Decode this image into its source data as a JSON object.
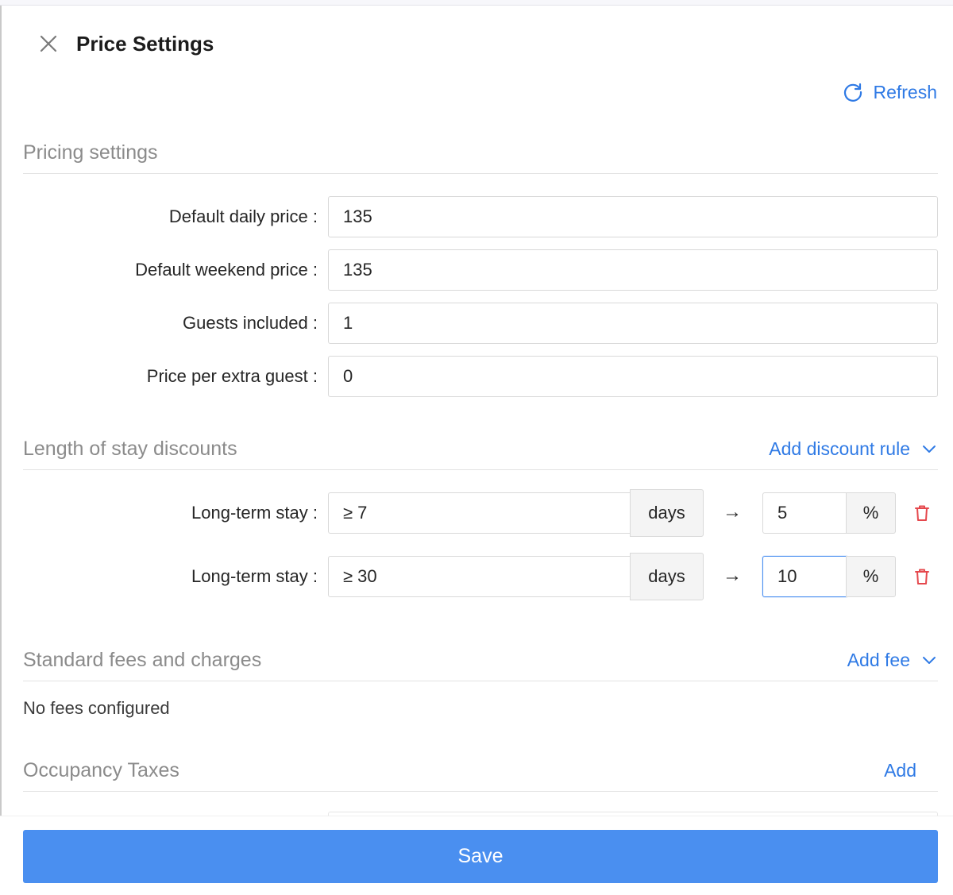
{
  "drawer": {
    "title": "Price Settings",
    "refresh_label": "Refresh",
    "save_label": "Save"
  },
  "pricing": {
    "section_title": "Pricing settings",
    "fields": [
      {
        "label": "Default daily price",
        "value": "135"
      },
      {
        "label": "Default weekend price",
        "value": "135"
      },
      {
        "label": "Guests included",
        "value": "1"
      },
      {
        "label": "Price per extra guest",
        "value": "0"
      }
    ]
  },
  "discounts": {
    "section_title": "Length of stay discounts",
    "add_label": "Add discount rule",
    "rules": [
      {
        "label": "Long-term stay",
        "min_days": "≥ 7",
        "days_unit": "days",
        "arrow": "→",
        "percent": "5",
        "percent_unit": "%"
      },
      {
        "label": "Long-term stay",
        "min_days": "≥ 30",
        "days_unit": "days",
        "arrow": "→",
        "percent": "10",
        "percent_unit": "%"
      }
    ]
  },
  "fees": {
    "section_title": "Standard fees and charges",
    "add_label": "Add fee",
    "empty_text": "No fees configured"
  },
  "taxes": {
    "section_title": "Occupancy Taxes",
    "add_label": "Add"
  },
  "colors": {
    "accent": "#2f7ae5",
    "primary_button": "#4a8ff0",
    "danger": "#e5484d",
    "section_title": "#8b8b8b"
  },
  "icons": {
    "close": "close-icon",
    "refresh": "refresh-icon",
    "chevron": "chevron-down-icon",
    "delete": "trash-icon"
  }
}
